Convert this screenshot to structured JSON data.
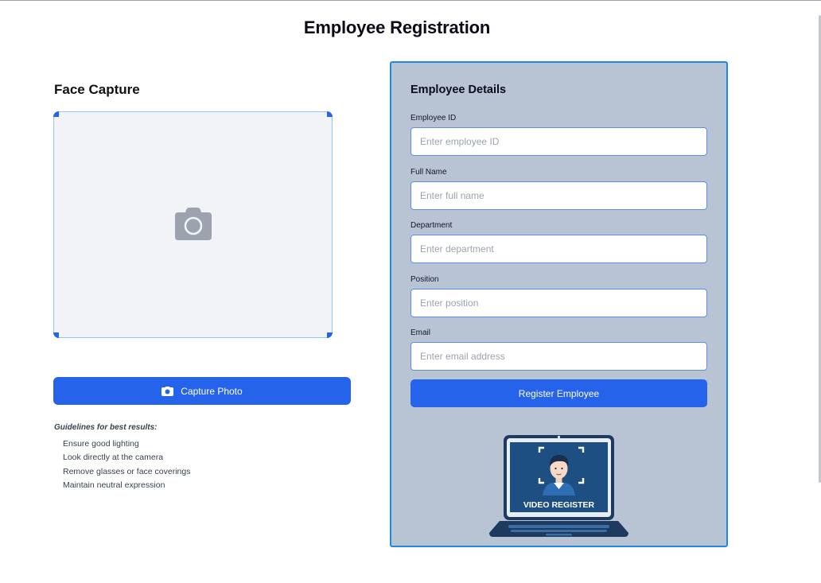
{
  "page": {
    "title": "Employee Registration"
  },
  "face_capture": {
    "title": "Face Capture",
    "placeholder_icon": "camera-icon",
    "capture_button_label": "Capture Photo",
    "guidelines_title": "Guidelines for best results:",
    "guidelines": [
      "Ensure good lighting",
      "Look directly at the camera",
      "Remove glasses or face coverings",
      "Maintain neutral expression"
    ]
  },
  "employee_details": {
    "title": "Employee Details",
    "fields": [
      {
        "label": "Employee ID",
        "placeholder": "Enter employee ID",
        "value": ""
      },
      {
        "label": "Full Name",
        "placeholder": "Enter full name",
        "value": ""
      },
      {
        "label": "Department",
        "placeholder": "Enter department",
        "value": ""
      },
      {
        "label": "Position",
        "placeholder": "Enter position",
        "value": ""
      },
      {
        "label": "Email",
        "placeholder": "Enter email address",
        "value": ""
      }
    ],
    "register_button_label": "Register Employee",
    "illustration": {
      "caption": "VIDEO REGISTER",
      "icon": "laptop-face-scan-illustration"
    }
  },
  "colors": {
    "primary": "#2563eb",
    "panel_bg": "#b8c4d3",
    "panel_border": "#1e88e5",
    "capture_bg": "#f1f3f6",
    "illustration_dark": "#1e3a5f"
  }
}
